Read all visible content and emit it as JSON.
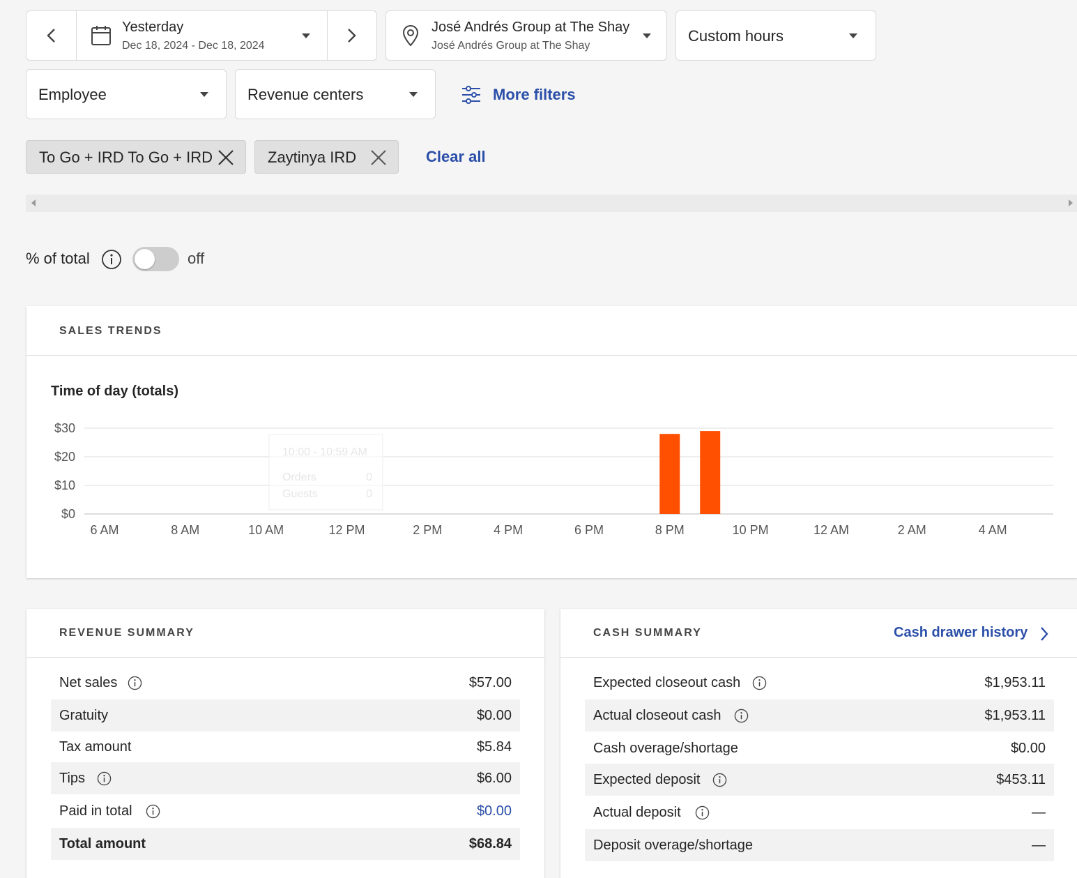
{
  "date_picker": {
    "period": "Yesterday",
    "range": "Dec 18, 2024 - Dec 18, 2024"
  },
  "location": {
    "name": "José Andrés Group at The Shay",
    "sub": "José Andrés Group at The Shay"
  },
  "hours_select": "Custom hours",
  "employee_select": "Employee",
  "revenue_centers_select": "Revenue centers",
  "more_filters": "More filters",
  "chips": [
    "To Go + IRD To Go + IRD",
    "Zaytinya IRD"
  ],
  "clear_all": "Clear all",
  "percent_toggle": {
    "label": "% of total",
    "state": "off"
  },
  "sales_trends": {
    "title": "SALES TRENDS",
    "chart_title": "Time of day (totals)"
  },
  "chart_data": {
    "type": "bar",
    "title": "Time of day (totals)",
    "x_ticks": [
      "6 AM",
      "8 AM",
      "10 AM",
      "12 PM",
      "2 PM",
      "4 PM",
      "6 PM",
      "8 PM",
      "10 PM",
      "12 AM",
      "2 AM",
      "4 AM"
    ],
    "y_ticks": [
      "$30",
      "$20",
      "$10",
      "$0"
    ],
    "ylim": [
      0,
      30
    ],
    "hours_start": 5.5,
    "hours_end": 29.5,
    "bars": [
      {
        "hour": 20,
        "value": 28
      },
      {
        "hour": 21,
        "value": 29
      }
    ],
    "bar_color": "#ff4f00",
    "grid": true,
    "tooltip": {
      "time": "10:00 - 10:59 AM",
      "rows": [
        {
          "label": "Orders",
          "value": "0"
        },
        {
          "label": "Guests",
          "value": "0"
        }
      ]
    }
  },
  "revenue_summary": {
    "title": "REVENUE SUMMARY",
    "rows": [
      {
        "label": "Net sales",
        "value": "$57.00"
      },
      {
        "label": "Gratuity",
        "value": "$0.00"
      },
      {
        "label": "Tax amount",
        "value": "$5.84"
      },
      {
        "label": "Tips",
        "value": "$6.00"
      },
      {
        "label": "Paid in total",
        "value": "$0.00"
      },
      {
        "label": "Total amount",
        "value": "$68.84"
      }
    ]
  },
  "cash_summary": {
    "title": "CASH SUMMARY",
    "link": "Cash drawer history",
    "rows": [
      {
        "label": "Expected closeout cash",
        "value": "$1,953.11"
      },
      {
        "label": "Actual closeout cash",
        "value": "$1,953.11"
      },
      {
        "label": "Cash overage/shortage",
        "value": "$0.00"
      },
      {
        "label": "Expected deposit",
        "value": "$453.11"
      },
      {
        "label": "Actual deposit",
        "value": "—"
      },
      {
        "label": "Deposit overage/shortage",
        "value": "—"
      }
    ]
  },
  "colors": {
    "accent": "#2b4fa8",
    "bar": "#ff4f00"
  }
}
